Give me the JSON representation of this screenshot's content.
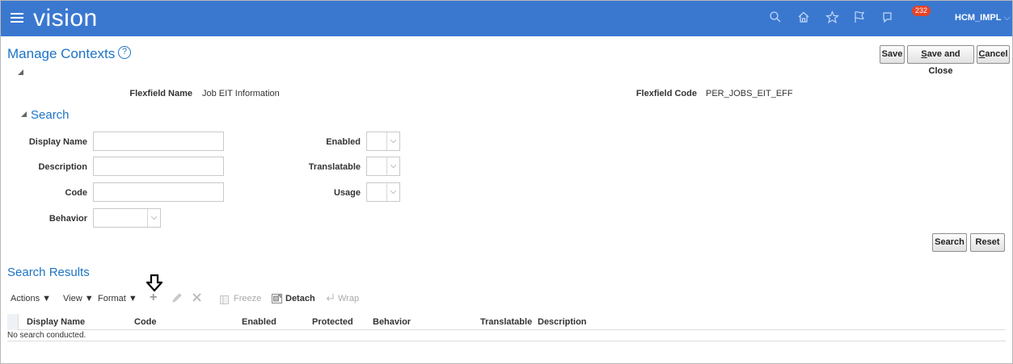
{
  "header": {
    "brand": "vision",
    "notifications_count": "232",
    "user": "HCM_IMPL",
    "icons": [
      "search-icon",
      "home-icon",
      "star-icon",
      "flag-icon",
      "notifications-icon"
    ],
    "bg_color": "#3a78d0"
  },
  "page": {
    "title": "Manage Contexts",
    "buttons": {
      "save": "Save",
      "save_close_prefix": "S",
      "save_close_rest": "ave and Close",
      "cancel_prefix": "C",
      "cancel_rest": "ancel"
    }
  },
  "info": {
    "flexfield_name_label": "Flexfield Name",
    "flexfield_name_value": "Job EIT Information",
    "flexfield_code_label": "Flexfield Code",
    "flexfield_code_value": "PER_JOBS_EIT_EFF"
  },
  "search": {
    "title": "Search",
    "fields": {
      "display_name": {
        "label": "Display Name",
        "value": ""
      },
      "description": {
        "label": "Description",
        "value": ""
      },
      "code": {
        "label": "Code",
        "value": ""
      },
      "behavior": {
        "label": "Behavior",
        "value": ""
      },
      "enabled": {
        "label": "Enabled",
        "value": ""
      },
      "translatable": {
        "label": "Translatable",
        "value": ""
      },
      "usage": {
        "label": "Usage",
        "value": ""
      }
    },
    "search_button": "Search",
    "reset_button": "Reset"
  },
  "results": {
    "title": "Search Results",
    "toolbar": {
      "actions": "Actions ▼",
      "view": "View ▼",
      "format": "Format ▼",
      "freeze": "Freeze",
      "detach": "Detach",
      "wrap": "Wrap"
    },
    "columns": [
      "Display Name",
      "Code",
      "Enabled",
      "Protected",
      "Behavior",
      "Translatable",
      "Description"
    ],
    "empty_message": "No search conducted."
  }
}
